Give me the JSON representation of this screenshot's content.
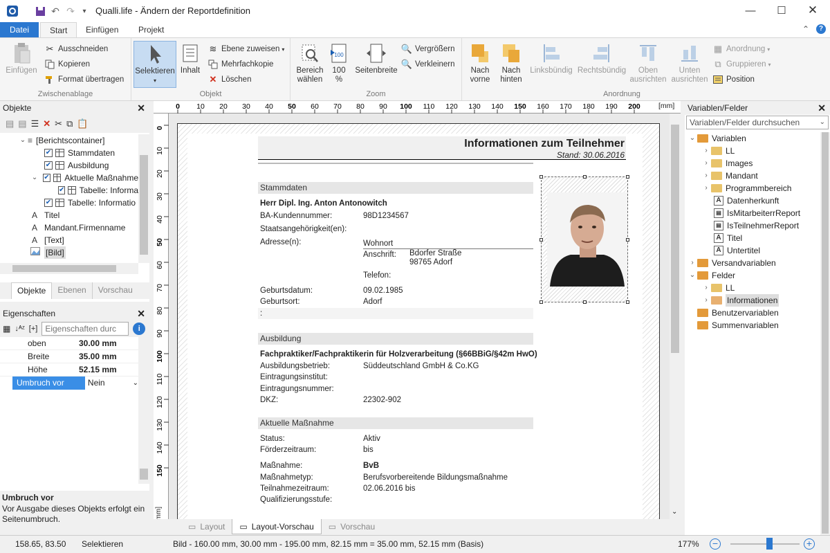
{
  "window": {
    "title": "Qualli.life - Ändern der Reportdefinition"
  },
  "tabs": {
    "file": "Datei",
    "start": "Start",
    "insert": "Einfügen",
    "project": "Projekt"
  },
  "ribbon": {
    "clipboard": {
      "label": "Zwischenablage",
      "paste": "Einfügen",
      "cut": "Ausschneiden",
      "copy": "Kopieren",
      "format": "Format übertragen"
    },
    "object": {
      "label": "Objekt",
      "select": "Selektieren",
      "content": "Inhalt",
      "assign_layer": "Ebene zuweisen",
      "multi_copy": "Mehrfachkopie",
      "delete": "Löschen"
    },
    "zoom": {
      "label": "Zoom",
      "area": "Bereich wählen",
      "hundred": "100 %",
      "page_width": "Seitenbreite",
      "zoom_in": "Vergrößern",
      "zoom_out": "Verkleinern"
    },
    "arrange": {
      "label": "Anordnung",
      "front": "Nach vorne",
      "back": "Nach hinten",
      "left": "Linksbündig",
      "right": "Rechtsbündig",
      "top": "Oben ausrichten",
      "bottom": "Unten ausrichten",
      "order": "Anordnung",
      "group": "Gruppieren",
      "position": "Position"
    }
  },
  "objects": {
    "title": "Objekte",
    "items": [
      "[Berichtscontainer]",
      "Stammdaten",
      "Ausbildung",
      "Aktuelle Maßnahme",
      "Tabelle: Informa",
      "Tabelle: Informatio",
      "Titel",
      "Mandant.Firmenname",
      "[Text]",
      "[Bild]"
    ],
    "tabs": [
      "Objekte",
      "Ebenen",
      "Vorschau"
    ]
  },
  "properties": {
    "title": "Eigenschaften",
    "search_placeholder": "Eigenschaften durc",
    "rows": [
      {
        "name": "oben",
        "value": "30.00 mm"
      },
      {
        "name": "Breite",
        "value": "35.00 mm"
      },
      {
        "name": "Höhe",
        "value": "52.15 mm"
      },
      {
        "name": "Umbruch vor",
        "value": "Nein"
      }
    ],
    "help_title": "Umbruch vor",
    "help_text": "Vor Ausgabe dieses Objekts erfolgt ein Seitenumbruch."
  },
  "ruler": {
    "unit": "[mm]",
    "h": [
      "0",
      "10",
      "20",
      "30",
      "40",
      "50",
      "60",
      "70",
      "80",
      "90",
      "100",
      "110",
      "120",
      "130",
      "140",
      "150",
      "160",
      "170",
      "180",
      "190",
      "200"
    ],
    "v": [
      "0",
      "10",
      "20",
      "30",
      "40",
      "50",
      "60",
      "70",
      "80",
      "90",
      "100",
      "110",
      "120",
      "130",
      "140",
      "150"
    ]
  },
  "report": {
    "title": "Informationen zum Teilnehmer",
    "stand": "Stand: 30.06.2016",
    "stamm": {
      "header": "Stammdaten",
      "name": "Herr Dipl. Ing. Anton Antonowitch",
      "rows": [
        [
          "BA-Kundennummer:",
          "98D1234567"
        ],
        [
          "Staatsangehörigkeit(en):",
          ""
        ],
        [
          "Adresse(n):",
          "Wohnort"
        ]
      ],
      "anschrift_label": "Anschrift:",
      "street": "Bdorfer Straße",
      "city": "98765 Adorf",
      "telefon": "Telefon:",
      "rows2": [
        [
          "Geburtsdatum:",
          "09.02.1985"
        ],
        [
          "Geburtsort:",
          "Adorf"
        ],
        [
          ":",
          ""
        ]
      ]
    },
    "ausb": {
      "header": "Ausbildung",
      "name": "Fachpraktiker/Fachpraktikerin für Holzverarbeitung (§66BBiG/§42m HwO)",
      "rows": [
        [
          "Ausbildungsbetrieb:",
          "Süddeutschland GmbH & Co.KG"
        ],
        [
          "Eintragungsinstitut:",
          ""
        ],
        [
          "Eintragungsnummer:",
          ""
        ],
        [
          "DKZ:",
          "22302-902"
        ]
      ]
    },
    "akt": {
      "header": "Aktuelle Maßnahme",
      "rows": [
        [
          "Status:",
          "Aktiv"
        ],
        [
          "Förderzeitraum:",
          "bis"
        ]
      ],
      "rows2": [
        [
          "Maßnahme:",
          "BvB"
        ],
        [
          "Maßnahmetyp:",
          "Berufsvorbereitende Bildungsmaßnahme"
        ],
        [
          "Teilnahmezeitraum:",
          "02.06.2016 bis"
        ],
        [
          "Qualifizierungsstufe:",
          ""
        ]
      ]
    }
  },
  "bottom_tabs": [
    "Layout",
    "Layout-Vorschau",
    "Vorschau"
  ],
  "vars": {
    "title": "Variablen/Felder",
    "search_placeholder": "Variablen/Felder durchsuchen",
    "items": [
      "Variablen",
      "LL",
      "Images",
      "Mandant",
      "Programmbereich",
      "Datenherkunft",
      "IsMitarbeiterrReport",
      "IsTeilnehmerReport",
      "Titel",
      "Untertitel",
      "Versandvariablen",
      "Felder",
      "LL",
      "Informationen",
      "Benutzervariablen",
      "Summenvariablen"
    ]
  },
  "status": {
    "coords": "158.65, 83.50",
    "mode": "Selektieren",
    "info": "Bild  -  160.00 mm, 30.00 mm  -  195.00 mm, 82.15 mm  =  35.00 mm, 52.15 mm (Basis)",
    "zoom": "177%"
  }
}
